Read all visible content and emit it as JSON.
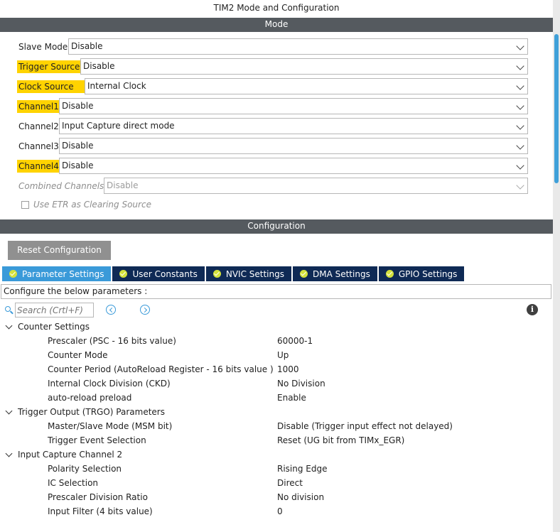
{
  "window": {
    "title": "TIM2 Mode and Configuration"
  },
  "mode_section": {
    "header": "Mode",
    "rows": [
      {
        "label": "Slave Mode",
        "value": "Disable"
      },
      {
        "label": "Trigger Source",
        "value": "Disable"
      },
      {
        "label": "Clock Source",
        "value": "Internal Clock"
      },
      {
        "label": "Channel1",
        "value": "Disable"
      },
      {
        "label": "Channel2",
        "value": "Input Capture direct mode"
      },
      {
        "label": "Channel3",
        "value": "Disable"
      },
      {
        "label": "Channel4",
        "value": "Disable"
      },
      {
        "label": "Combined Channels",
        "value": "Disable"
      }
    ],
    "etr_checkbox_label": "Use ETR as Clearing Source",
    "highlight_color": "#ffd300"
  },
  "config_section": {
    "header": "Configuration",
    "reset_button": "Reset Configuration",
    "tabs": [
      {
        "label": "Parameter Settings"
      },
      {
        "label": "User Constants"
      },
      {
        "label": "NVIC Settings"
      },
      {
        "label": "DMA Settings"
      },
      {
        "label": "GPIO Settings"
      }
    ],
    "describe_text": "Configure the below parameters :",
    "search_placeholder": "Search (Crtl+F)",
    "info_glyph": "i",
    "groups": [
      {
        "label": "Counter Settings",
        "params": [
          {
            "name": "Prescaler (PSC - 16 bits value)",
            "value": "60000-1"
          },
          {
            "name": "Counter Mode",
            "value": "Up"
          },
          {
            "name": "Counter Period (AutoReload Register - 16 bits value )",
            "value": "1000"
          },
          {
            "name": "Internal Clock Division (CKD)",
            "value": "No Division"
          },
          {
            "name": "auto-reload preload",
            "value": "Enable"
          }
        ]
      },
      {
        "label": "Trigger Output (TRGO) Parameters",
        "params": [
          {
            "name": "Master/Slave Mode (MSM bit)",
            "value": "Disable (Trigger input effect not delayed)"
          },
          {
            "name": "Trigger Event Selection",
            "value": "Reset (UG bit from TIMx_EGR)"
          }
        ]
      },
      {
        "label": "Input Capture Channel 2",
        "params": [
          {
            "name": "Polarity Selection",
            "value": "Rising Edge"
          },
          {
            "name": "IC Selection",
            "value": "Direct"
          },
          {
            "name": "Prescaler Division Ratio",
            "value": "No division"
          },
          {
            "name": "Input Filter (4 bits value)",
            "value": "0"
          }
        ]
      }
    ]
  }
}
